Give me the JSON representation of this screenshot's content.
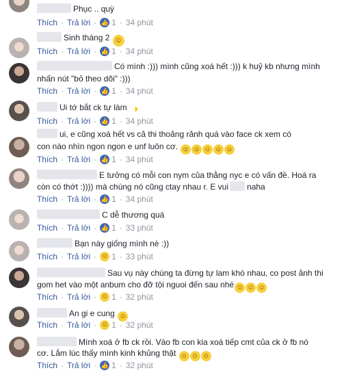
{
  "actions": {
    "like": "Thích",
    "reply": "Trả lời",
    "dot": "·"
  },
  "comments": [
    {
      "text": "Phục .. quỳ",
      "likes": "1",
      "time": "34 phút",
      "emoji": ""
    },
    {
      "text": "Sinh tháng 2",
      "likes": "1",
      "time": "34 phút",
      "emoji": "smile"
    },
    {
      "lines": [
        "Có mình :))) mình cũng xoá hết :))) k huỷ kb nhưng mình",
        "nhấn nút \"bỏ theo dõi\" :)))"
      ],
      "likes": "1",
      "time": "34 phút"
    },
    {
      "text": "Ui tớ bắt ck tự làm",
      "likes": "1",
      "time": "34 phút",
      "emoji": "pacman"
    },
    {
      "lines": [
        "ui, e cũng xoá hết vs cả thi thoảng rảnh quá vào face ck xem có",
        "con nào nhìn ngon ngon e unf luôn cơ."
      ],
      "likes": "1",
      "time": "34 phút",
      "emoji": "rofl-x5"
    },
    {
      "lines": [
        "E tưởng có mỗi con nym của thằng nyc e có vấn đề. Hoá ra",
        "còn có thớt :)))) mà chúng nó cũng ctay nhau r. E vui",
        "naha"
      ],
      "likes": "1",
      "time": "34 phút"
    },
    {
      "text": "C dễ thương quá",
      "likes": "1",
      "time": "33 phút"
    },
    {
      "text": "Bạn này giống mình nè :))",
      "likes": "1",
      "time": "33 phút"
    },
    {
      "lines": [
        "Sau vụ này chúng ta đừng tự lam khó nhau, co post ảnh thi",
        "gom het vào một anbum cho đỡ tội nguoi đến sau nhé"
      ],
      "likes": "1",
      "time": "32 phút",
      "emoji": "laugh-x3"
    },
    {
      "text": "An gi e cung",
      "likes": "1",
      "time": "32 phút",
      "emoji": "woman"
    },
    {
      "lines": [
        "Mình xoá ở fb ck rồi. Vào fb con kia xoá tiếp cmt của ck ở fb nó",
        "cơ. Lắm lúc thấy mình kinh khủng thật"
      ],
      "likes": "1",
      "time": "32 phút",
      "emoji": "laugh-x3"
    }
  ]
}
